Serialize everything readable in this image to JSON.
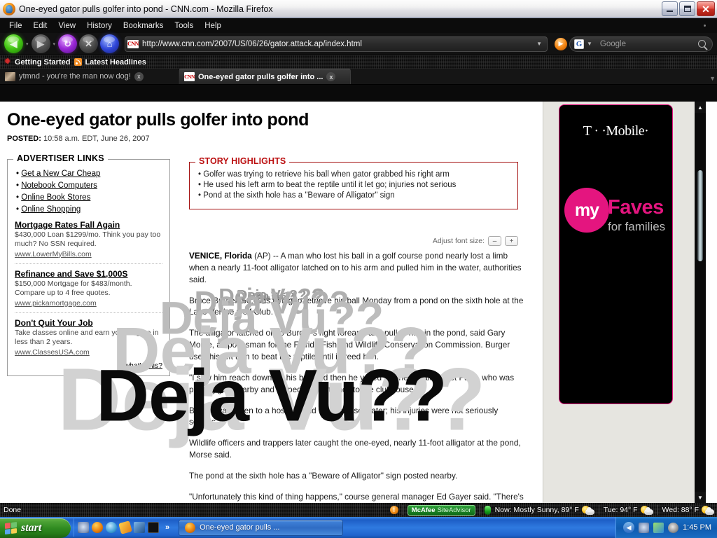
{
  "window": {
    "title": "One-eyed gator pulls golfer into pond - CNN.com - Mozilla Firefox",
    "minimize_label": "Minimize",
    "maximize_label": "Restore",
    "close_label": "Close"
  },
  "menubar": {
    "items": [
      "File",
      "Edit",
      "View",
      "History",
      "Bookmarks",
      "Tools",
      "Help"
    ]
  },
  "navbar": {
    "back_label": "Back",
    "forward_label": "Forward",
    "reload_label": "Reload",
    "stop_label": "Stop",
    "home_label": "Home",
    "url": "http://www.cnn.com/2007/US/06/26/gator.attack.ap/index.html",
    "go_label": "Go",
    "search_engine": "Google",
    "search_placeholder": "Google"
  },
  "bookmarks": {
    "items": [
      "Getting Started",
      "Latest Headlines"
    ]
  },
  "tabs": [
    {
      "title": "ytmnd - you're the man now dog!",
      "active": false,
      "close": "x"
    },
    {
      "title": "One-eyed gator pulls golfer into ...",
      "active": true,
      "close": "x"
    }
  ],
  "page": {
    "headline": "One-eyed gator pulls golfer into pond",
    "posted_label": "POSTED:",
    "posted_value": "10:58 a.m. EDT, June 26, 2007",
    "advertiser": {
      "title": "ADVERTISER LINKS",
      "links": [
        "Get a New Car Cheap",
        "Notebook Computers",
        "Online Book Stores",
        "Online Shopping"
      ],
      "ads": [
        {
          "heading": "Mortgage Rates Fall Again",
          "body": "$430,000 Loan $1299/mo. Think you pay too much? No SSN required.",
          "url": "www.LowerMyBills.com"
        },
        {
          "heading": "Refinance and Save $1,000S",
          "body": "$150,000 Mortgage for $483/month. Compare up to 4 free quotes.",
          "url": "www.pickamortgage.com"
        },
        {
          "heading": "Don't Quit Your Job",
          "body": "Take classes online and earn your degree in less than 2 years.",
          "url": "www.ClassesUSA.com"
        }
      ],
      "whats_this": "what's this?"
    },
    "highlights": {
      "title": "STORY HIGHLIGHTS",
      "items": [
        "• Golfer was trying to retrieve his ball when gator grabbed his right arm",
        "• He used his left arm to beat the reptile until it let go; injuries not serious",
        "• Pond at the sixth hole has a \"Beware of Alligator\" sign"
      ]
    },
    "font_size": {
      "label": "Adjust font size:",
      "decrease": "–",
      "increase": "+"
    },
    "article": {
      "dateline": "VENICE, Florida",
      "paragraphs": [
        "(AP) -- A man who lost his ball in a golf course pond nearly lost a limb when a nearly 11-foot alligator latched on to his arm and pulled him in the water, authorities said.",
        "Bruce Burger, 50, was trying to retrieve his ball Monday from a pond on the sixth hole at the Lake Venice Golf Club.",
        "The alligator latched on to Burger's right forearm and pulled him in the pond, said Gary Morse, a spokesman for the Florida Fish and Wildlife Conservation Commission. Burger used his left arm to beat the reptile until it freed him.",
        "\"I saw him reach down for his ball and then he yelled\" for help, said Janet Pallo, who was playing golf nearby and helped him get back to the clubhouse.",
        "Burger was taken to a hospital and was released later; his injuries were not seriously serious.",
        "Wildlife officers and trappers later caught the one-eyed, nearly 11-foot alligator at the pond, Morse said.",
        "The pond at the sixth hole has a \"Beware of Alligator\" sign posted nearby.",
        "\"Unfortunately this kind of thing happens,\" course general manager Ed Gayer said. \"There's wildlife in these ponds.\""
      ]
    },
    "ad_rail": {
      "brand": "T · ·Mobile·",
      "my": "my",
      "faves": "Faves",
      "tagline": "for families"
    },
    "overlay_text": "Deja Vu??"
  },
  "statusbar": {
    "status": "Done",
    "mcafee_brand": "McAfee",
    "mcafee_product": "SiteAdvisor",
    "weather": [
      "Now: Mostly Sunny, 89° F",
      "Tue: 94° F",
      "Wed: 88° F"
    ]
  },
  "taskbar": {
    "start_label": "start",
    "quicklaunch_more": "»",
    "task_title": "One-eyed gator pulls ...",
    "clock": "1:45 PM"
  }
}
